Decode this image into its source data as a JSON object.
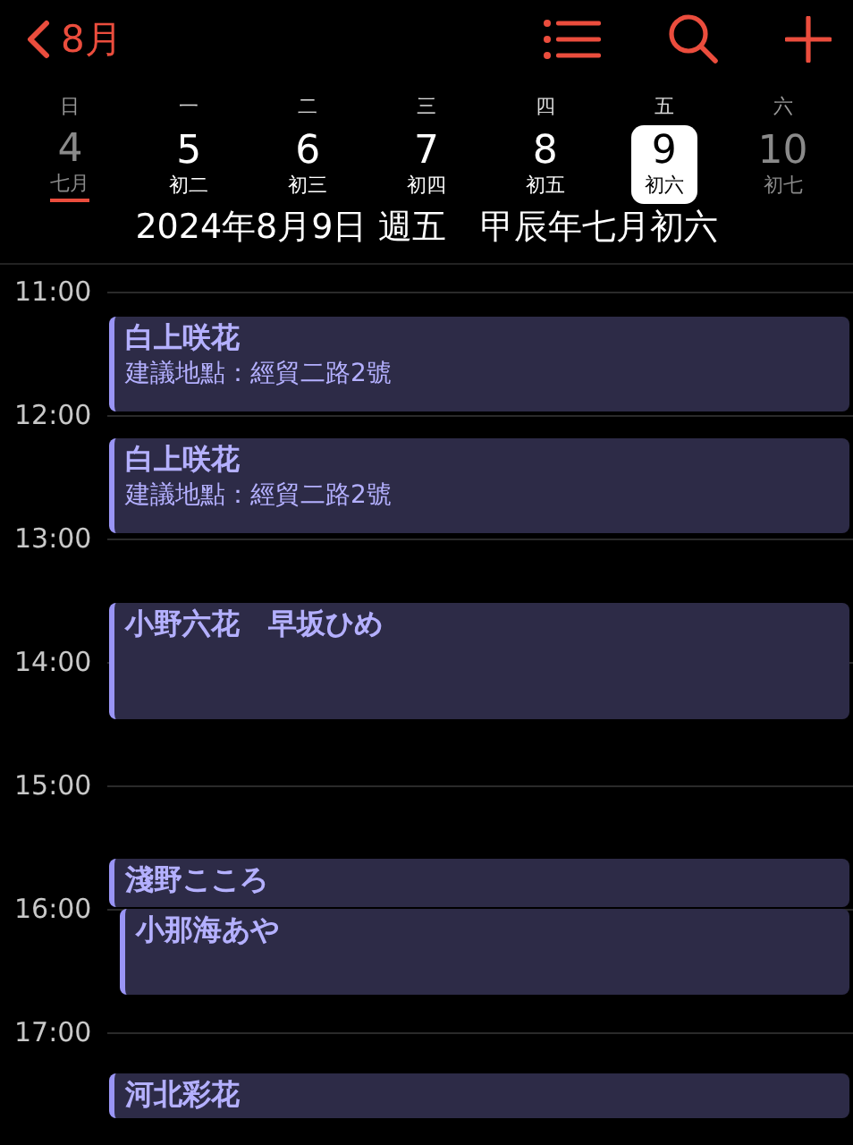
{
  "nav": {
    "back_label": "8月"
  },
  "week": [
    {
      "weekday": "日",
      "date": "4",
      "lunar": "七月",
      "weekend": true,
      "selected": false,
      "month_start": true
    },
    {
      "weekday": "一",
      "date": "5",
      "lunar": "初二",
      "weekend": false,
      "selected": false,
      "month_start": false
    },
    {
      "weekday": "二",
      "date": "6",
      "lunar": "初三",
      "weekend": false,
      "selected": false,
      "month_start": false
    },
    {
      "weekday": "三",
      "date": "7",
      "lunar": "初四",
      "weekend": false,
      "selected": false,
      "month_start": false
    },
    {
      "weekday": "四",
      "date": "8",
      "lunar": "初五",
      "weekend": false,
      "selected": false,
      "month_start": false
    },
    {
      "weekday": "五",
      "date": "9",
      "lunar": "初六",
      "weekend": false,
      "selected": true,
      "month_start": false
    },
    {
      "weekday": "六",
      "date": "10",
      "lunar": "初七",
      "weekend": true,
      "selected": false,
      "month_start": false
    }
  ],
  "selected_date": "2024年8月9日 週五　甲辰年七月初六",
  "hours": [
    "11:00",
    "12:00",
    "13:00",
    "14:00",
    "15:00",
    "16:00",
    "17:00"
  ],
  "events": [
    {
      "title": "白上咲花",
      "location": "建議地點：經貿二路2號"
    },
    {
      "title": "白上咲花",
      "location": "建議地點：經貿二路2號"
    },
    {
      "title": "小野六花　早坂ひめ"
    },
    {
      "title": "淺野こころ"
    },
    {
      "title": "小那海あや"
    },
    {
      "title": "河北彩花"
    }
  ]
}
